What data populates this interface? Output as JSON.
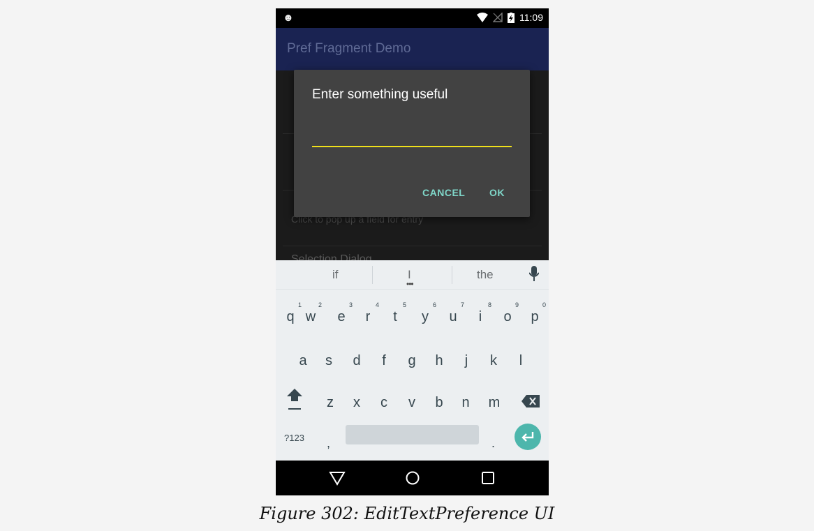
{
  "status_bar": {
    "time": "11:09",
    "icons": [
      "android-icon",
      "wifi-icon",
      "no-signal-icon",
      "battery-charging-icon"
    ]
  },
  "app_bar": {
    "title": "Pref Fragment Demo"
  },
  "preferences": {
    "edit_summary": "Click to pop up a field for entry",
    "selection_title": "Selection Dialog"
  },
  "dialog": {
    "title": "Enter something useful",
    "input_value": "",
    "cancel_label": "CANCEL",
    "ok_label": "OK",
    "accent_color": "#f0e01a",
    "button_color": "#7fd7c9"
  },
  "keyboard": {
    "suggestions": [
      "if",
      "I",
      "the"
    ],
    "row1": [
      {
        "key": "q",
        "hint": "1"
      },
      {
        "key": "w",
        "hint": "2"
      },
      {
        "key": "e",
        "hint": "3"
      },
      {
        "key": "r",
        "hint": "4"
      },
      {
        "key": "t",
        "hint": "5"
      },
      {
        "key": "y",
        "hint": "6"
      },
      {
        "key": "u",
        "hint": "7"
      },
      {
        "key": "i",
        "hint": "8"
      },
      {
        "key": "o",
        "hint": "9"
      },
      {
        "key": "p",
        "hint": "0"
      }
    ],
    "row2": [
      "a",
      "s",
      "d",
      "f",
      "g",
      "h",
      "j",
      "k",
      "l"
    ],
    "row3": [
      "z",
      "x",
      "c",
      "v",
      "b",
      "n",
      "m"
    ],
    "symbols_label": "?123",
    "comma": ",",
    "period": ".",
    "enter_color": "#4db6ac"
  },
  "caption": "Figure 302: EditTextPreference UI"
}
